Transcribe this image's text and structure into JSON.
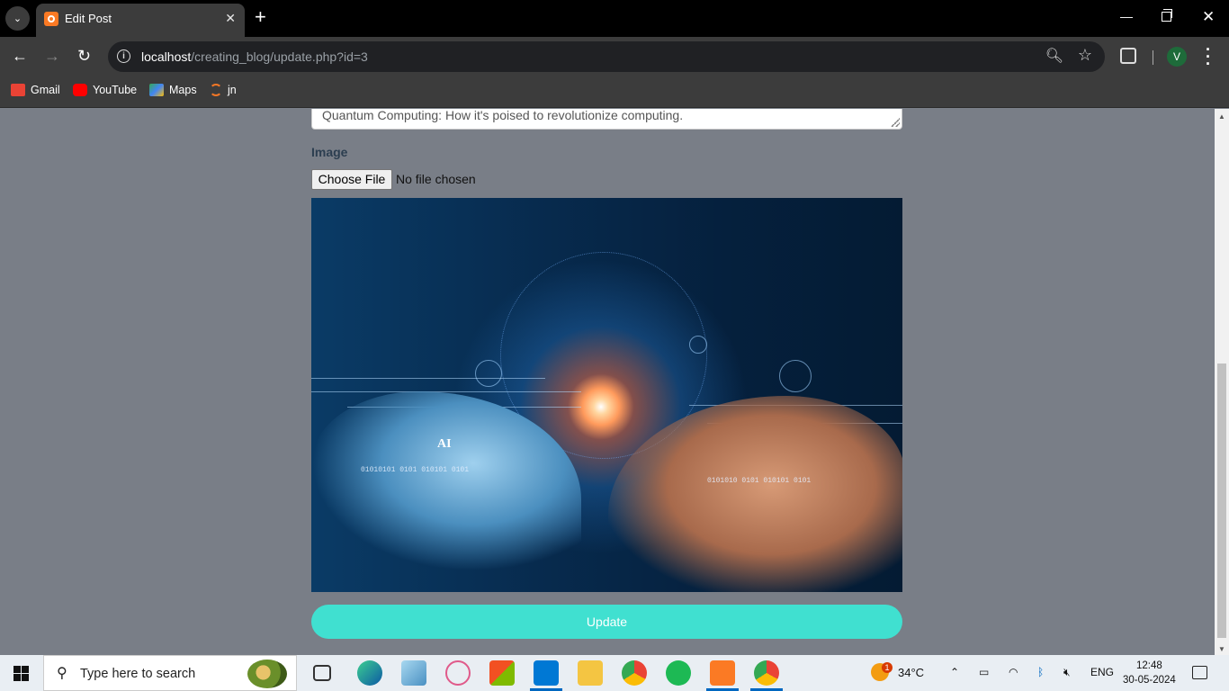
{
  "browser": {
    "tab_title": "Edit Post",
    "url_host": "localhost",
    "url_path": "/creating_blog/update.php?id=3",
    "profile_initial": "V"
  },
  "bookmarks": [
    {
      "label": "Gmail",
      "icon": "gmail-icon",
      "color": "#ea4335"
    },
    {
      "label": "YouTube",
      "icon": "youtube-icon",
      "color": "#ff0000"
    },
    {
      "label": "Maps",
      "icon": "maps-icon",
      "color": "#34a853"
    },
    {
      "label": "jn",
      "icon": "jupyter-icon",
      "color": "#f37726"
    }
  ],
  "form": {
    "description_value": "Quantum Computing: How it's poised to revolutionize computing.",
    "image_label": "Image",
    "file_button": "Choose File",
    "file_status": "No file chosen",
    "image_text_ai": "AI",
    "update_button": "Update"
  },
  "colors": {
    "update_button": "#40e0d0",
    "page_background": "#797e87"
  },
  "taskbar": {
    "search_placeholder": "Type here to search",
    "weather_temp": "34°C",
    "weather_badge": "1",
    "language": "ENG",
    "time": "12:48",
    "date": "30-05-2024"
  }
}
